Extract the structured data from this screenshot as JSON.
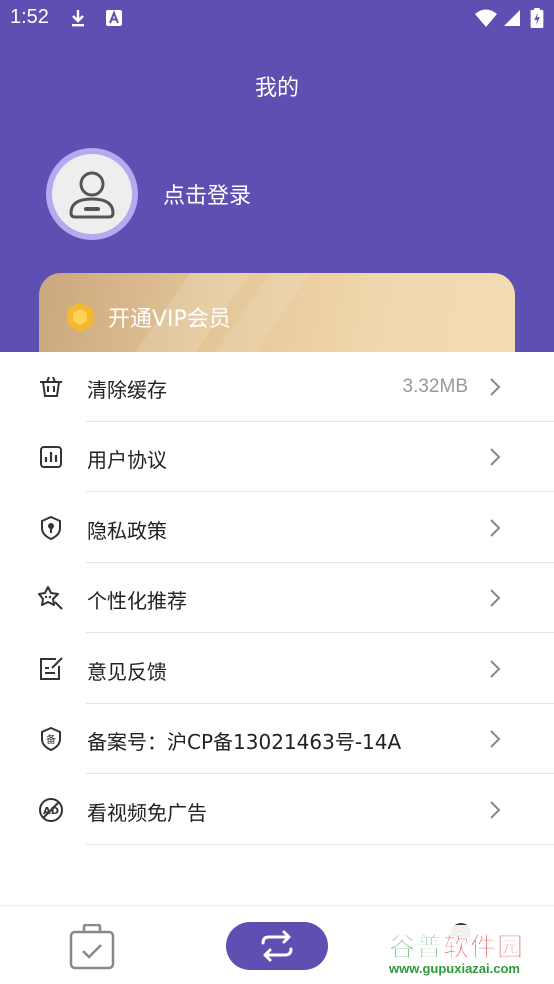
{
  "status_bar": {
    "time": "1:52"
  },
  "header": {
    "title": "我的",
    "login_text": "点击登录"
  },
  "vip": {
    "label": "开通VIP会员"
  },
  "menu": [
    {
      "label": "清除缓存",
      "value": "3.32MB",
      "icon": "basket-icon"
    },
    {
      "label": "用户协议",
      "value": "",
      "icon": "chart-doc-icon"
    },
    {
      "label": "隐私政策",
      "value": "",
      "icon": "shield-lock-icon"
    },
    {
      "label": "个性化推荐",
      "value": "",
      "icon": "star-cursor-icon"
    },
    {
      "label": "意见反馈",
      "value": "",
      "icon": "edit-note-icon"
    },
    {
      "label": "备案号：沪CP备13021463号-14A",
      "value": "",
      "icon": "record-badge-icon"
    },
    {
      "label": "看视频免广告",
      "value": "",
      "icon": "no-ad-icon"
    }
  ],
  "watermark": {
    "title_green": "谷普",
    "title_red": "软件园",
    "url": "www.gupuxiazai.com"
  },
  "colors": {
    "primary": "#5e4fb3",
    "vip_gold": "#e3c596",
    "text": "#222222",
    "muted": "#999999"
  }
}
